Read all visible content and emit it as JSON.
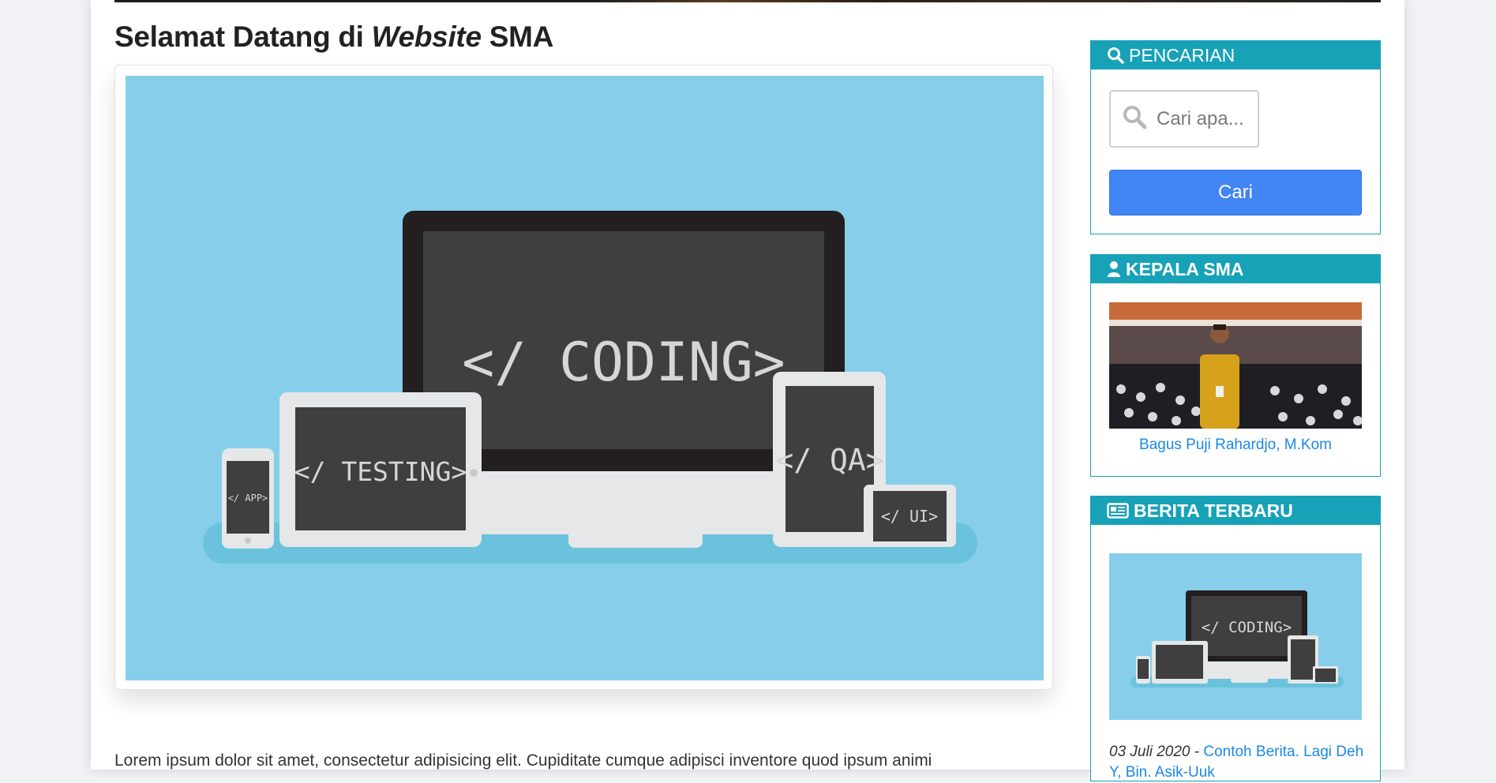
{
  "page": {
    "title_before": "Selamat Datang di ",
    "title_italic": "Website",
    "title_after": " SMA"
  },
  "hero": {
    "main_label": "</ CODING>",
    "tablet_label": "</ TESTING>",
    "phone_label": "</ APP>",
    "vertical_tablet_label": "</ QA>",
    "small_label": "</ UI>",
    "colors": {
      "background": "#87ceea",
      "platform": "#6ac2dd",
      "dark": "#403f40",
      "device": "#e6e7e8"
    }
  },
  "body_text": "Lorem ipsum dolor sit amet, consectetur adipisicing elit. Cupiditate cumque adipisci inventore quod ipsum animi",
  "sidebar": {
    "search": {
      "heading": "PENCARIAN",
      "heading_icon": "search-icon",
      "placeholder": "Cari apa...",
      "button_label": "Cari"
    },
    "kepala": {
      "heading": "KEPALA SMA",
      "heading_icon": "user-icon",
      "name": "Bagus Puji Rahardjo, M.Kom"
    },
    "berita": {
      "heading": "BERITA TERBARU",
      "heading_icon": "newspaper-icon",
      "thumb_label": "</ CODING>",
      "date": "03 Juli 2020 - ",
      "link": "Contoh Berita. Lagi Deh Y, Bin. Asik-Uuk"
    }
  },
  "colors": {
    "accent": "#17a2b8",
    "button": "#4285f4",
    "link": "#1a88e6"
  }
}
